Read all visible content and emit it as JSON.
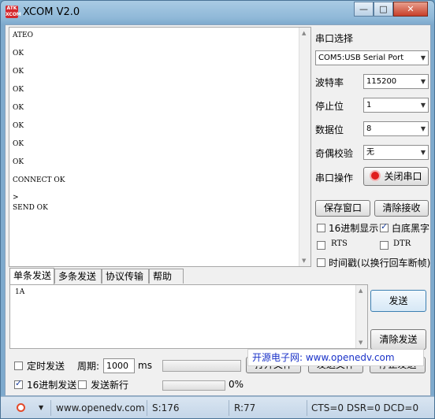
{
  "window": {
    "title": "XCOM V2.0",
    "icon_text": "ATK XCOM",
    "controls": {
      "minimize": "—",
      "maximize": "□",
      "close": "✕"
    }
  },
  "receive": {
    "lines": [
      "ATEO",
      "OK",
      "OK",
      "OK",
      "OK",
      "OK",
      "OK",
      "OK",
      "CONNECT OK",
      ">",
      "SEND OK"
    ]
  },
  "settings": {
    "port_label": "串口选择",
    "port_value": "COM5:USB Serial Port",
    "baud_label": "波特率",
    "baud_value": "115200",
    "stopbit_label": "停止位",
    "stopbit_value": "1",
    "databit_label": "数据位",
    "databit_value": "8",
    "parity_label": "奇偶校验",
    "parity_value": "无",
    "op_label": "串口操作",
    "close_port_button": "关闭串口",
    "save_window_button": "保存窗口",
    "clear_receive_button": "清除接收",
    "hex_display_label": "16进制显示",
    "hex_display_checked": false,
    "white_bg_label": "白底黑字",
    "white_bg_checked": true,
    "rts_label": "RTS",
    "rts_checked": false,
    "dtr_label": "DTR",
    "dtr_checked": false,
    "timestamp_label": "时间戳(以换行回车断帧)",
    "timestamp_checked": false
  },
  "tabs": [
    "单条发送",
    "多条发送",
    "协议传输",
    "帮助"
  ],
  "send": {
    "text": "1A",
    "send_button": "发送",
    "clear_send_button": "清除发送"
  },
  "bottom": {
    "timed_send_label": "定时发送",
    "timed_send_checked": false,
    "period_label": "周期:",
    "period_value": "1000",
    "period_unit": "ms",
    "open_file_button": "打开文件",
    "send_file_button": "发送文件",
    "stop_send_button": "停止发送",
    "hex_send_label": "16进制发送",
    "hex_send_checked": true,
    "newline_label": "发送新行",
    "newline_checked": false,
    "progress_percent": "0%",
    "progress_value": 0,
    "banner": "开源电子网: www.openedv.com"
  },
  "statusbar": {
    "url": "www.openedv.com",
    "sent": "S:176",
    "received": "R:77",
    "signals": "CTS=0 DSR=0 DCD=0"
  },
  "colors": {
    "indicator_red": "#e01e1e",
    "banner_blue": "#1a32c8",
    "title_bar": "#8fb8d8"
  }
}
